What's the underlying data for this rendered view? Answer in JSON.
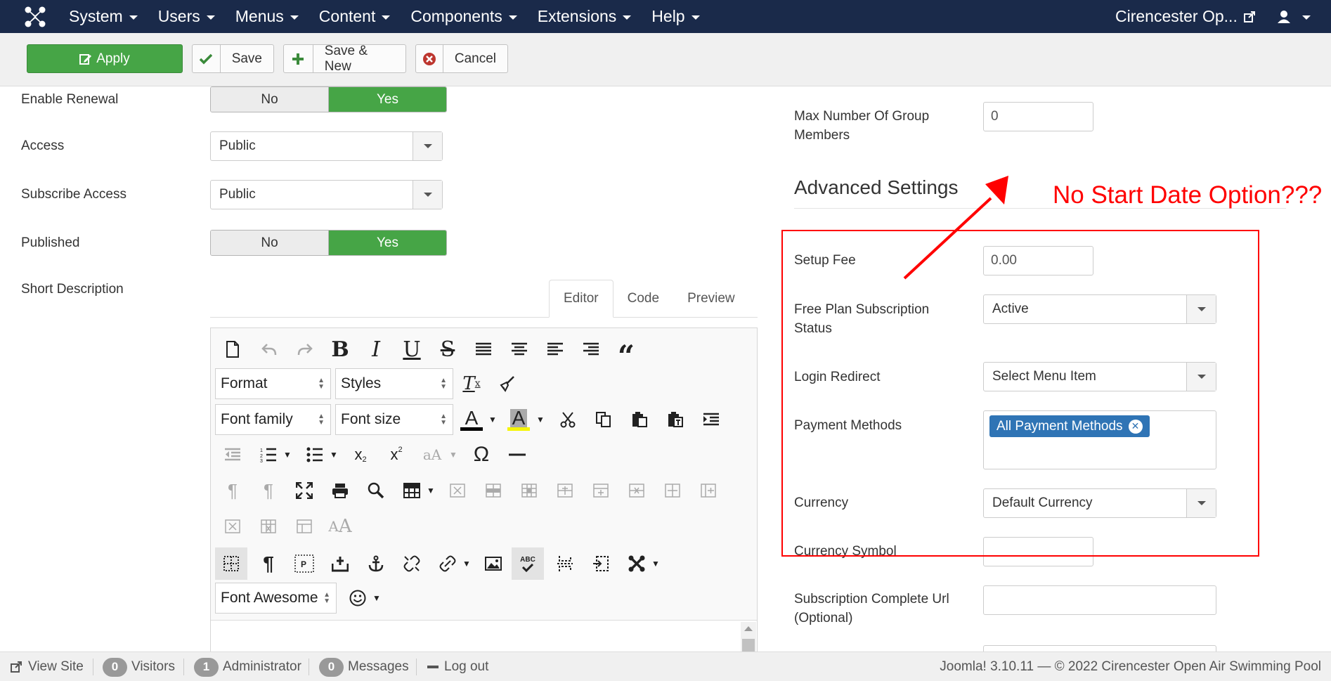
{
  "navbar": {
    "menu": [
      "System",
      "Users",
      "Menus",
      "Content",
      "Components",
      "Extensions",
      "Help"
    ],
    "site_name": "Cirencester Op..."
  },
  "toolbar": {
    "apply": "Apply",
    "save": "Save",
    "save_new": "Save & New",
    "cancel": "Cancel"
  },
  "left": {
    "enable_renewal": {
      "label": "Enable Renewal",
      "no": "No",
      "yes": "Yes",
      "value": "Yes"
    },
    "access": {
      "label": "Access",
      "value": "Public"
    },
    "subscribe_access": {
      "label": "Subscribe Access",
      "value": "Public"
    },
    "published": {
      "label": "Published",
      "no": "No",
      "yes": "Yes",
      "value": "Yes"
    },
    "short_description": {
      "label": "Short Description"
    }
  },
  "editor": {
    "tabs": [
      "Editor",
      "Code",
      "Preview"
    ],
    "active_tab": "Editor",
    "dropdowns": {
      "format": "Format",
      "styles": "Styles",
      "font_family": "Font family",
      "font_size": "Font size",
      "font_awesome": "Font Awesome"
    }
  },
  "right": {
    "max_group_members": {
      "label_line1": "Max Number Of Group",
      "label_line2": "Members",
      "value": "0"
    },
    "advanced_title": "Advanced Settings",
    "setup_fee": {
      "label": "Setup Fee",
      "value": "0.00"
    },
    "free_plan_status": {
      "label_line1": "Free Plan Subscription",
      "label_line2": "Status",
      "value": "Active"
    },
    "login_redirect": {
      "label": "Login Redirect",
      "value": "Select Menu Item"
    },
    "payment_methods": {
      "label": "Payment Methods",
      "chip": "All Payment Methods"
    },
    "currency": {
      "label": "Currency",
      "value": "Default Currency"
    },
    "currency_symbol": {
      "label": "Currency Symbol",
      "value": ""
    },
    "complete_url": {
      "label_line1": "Subscription Complete Url",
      "label_line2": "(Optional)",
      "value": ""
    }
  },
  "annotation": {
    "text": "No Start Date Option???",
    "color": "#ff0000"
  },
  "statusbar": {
    "view_site": "View Site",
    "visitors_count": "0",
    "visitors": "Visitors",
    "admin_count": "1",
    "admin": "Administrator",
    "messages_count": "0",
    "messages": "Messages",
    "logout": "Log out",
    "footer": "Joomla! 3.10.11  —  © 2022 Cirencester Open Air Swimming Pool"
  },
  "colors": {
    "navbar": "#1a2a4a",
    "success": "#46a546",
    "chip": "#2f74b5"
  }
}
